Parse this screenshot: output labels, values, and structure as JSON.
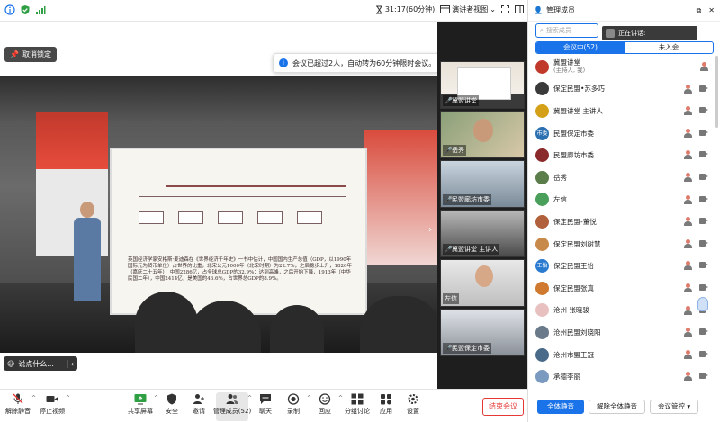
{
  "topbar": {
    "timer": "31:17(60分钟)",
    "speaker_view": "演讲者视图"
  },
  "main": {
    "unlock_label": "取消锁定",
    "banner_text": "会议已超过2人，自动转为60分钟限时会议。",
    "chat_placeholder": "说点什么...",
    "slide": {
      "body_text": "英国经济学家安格斯·麦迪森在《世界经济千年史》一书中估计，中国国内生产总值（GDP，以1990年国际元为货币单位）占世界的比重，北宋公元1000年（北宋时期）为22.7%，之后稳步上升，1820年（嘉庆二十五年），中国2286亿，占全球总GDP的32.9%；达到高峰，之后开始下降，1913年（中华民国二年），中国2414亿，是美国的46.6%，占世界总GDP的8.9%。"
    }
  },
  "thumbnails": [
    {
      "name": "冀盟讲堂",
      "accent": "#c0392b"
    },
    {
      "name": "岳秀",
      "accent": "#6b8e5a"
    },
    {
      "name": "民盟廊坊市委",
      "accent": "#7a8ea0"
    },
    {
      "name": "冀盟讲堂 主讲人",
      "accent": "#5a6b7a"
    },
    {
      "name": "左信",
      "accent": "#8a8a8a"
    },
    {
      "name": "民盟保定市委",
      "accent": "#9aa0a8"
    }
  ],
  "panel": {
    "title": "管理成员",
    "search_placeholder": "搜索成员",
    "speaking_label": "正在讲话:",
    "tabs": [
      "会议中(52)",
      "未入会"
    ],
    "members": [
      {
        "name": "冀盟讲堂",
        "sub": "(主持人, 我)",
        "avatar_color": "#c0392b",
        "avatar_text": "",
        "cam": false
      },
      {
        "name": "保定民盟•苏多巧",
        "sub": "",
        "avatar_color": "#3a3a3a",
        "avatar_text": "",
        "cam": true
      },
      {
        "name": "冀盟讲堂 主讲人",
        "sub": "",
        "avatar_color": "#d4a017",
        "avatar_text": "",
        "cam": true
      },
      {
        "name": "民盟保定市委",
        "sub": "",
        "avatar_color": "#2a6fb0",
        "avatar_text": "市委",
        "cam": true
      },
      {
        "name": "民盟廊坊市委",
        "sub": "",
        "avatar_color": "#8b2a2a",
        "avatar_text": "",
        "cam": true
      },
      {
        "name": "岳秀",
        "sub": "",
        "avatar_color": "#5a7d4a",
        "avatar_text": "",
        "cam": true
      },
      {
        "name": "左信",
        "sub": "",
        "avatar_color": "#4aa05a",
        "avatar_text": "",
        "cam": true
      },
      {
        "name": "保定民盟-董悦",
        "sub": "",
        "avatar_color": "#b0603a",
        "avatar_text": "",
        "cam": true
      },
      {
        "name": "保定民盟刘树慧",
        "sub": "",
        "avatar_color": "#c88a4a",
        "avatar_text": "",
        "cam": true
      },
      {
        "name": "保定民盟王怡",
        "sub": "",
        "avatar_color": "#2a7ad0",
        "avatar_text": "王怡",
        "cam": true
      },
      {
        "name": "保定民盟张真",
        "sub": "",
        "avatar_color": "#d07a30",
        "avatar_text": "",
        "cam": true
      },
      {
        "name": "沧州 张晓骏",
        "sub": "",
        "avatar_color": "#e8c0c0",
        "avatar_text": "",
        "cam": true
      },
      {
        "name": "沧州民盟刘晓阳",
        "sub": "",
        "avatar_color": "#6a7a8a",
        "avatar_text": "",
        "cam": true
      },
      {
        "name": "沧州市盟王冠",
        "sub": "",
        "avatar_color": "#4a6a8a",
        "avatar_text": "",
        "cam": true
      },
      {
        "name": "承德李丽",
        "sub": "",
        "avatar_color": "#7a9ac0",
        "avatar_text": "",
        "cam": true
      }
    ],
    "footer": {
      "mute_all": "全体静音",
      "unmute_all": "解除全体静音",
      "control": "会议管控"
    }
  },
  "toolbar": {
    "unmute": "解除静音",
    "stop_video": "停止视频",
    "share": "共享屏幕",
    "security": "安全",
    "invite": "邀请",
    "members": "管理成员(52)",
    "chat": "聊天",
    "record": "录制",
    "react": "回应",
    "breakout": "分组讨论",
    "apps": "应用",
    "settings": "设置",
    "end": "结束会议"
  }
}
